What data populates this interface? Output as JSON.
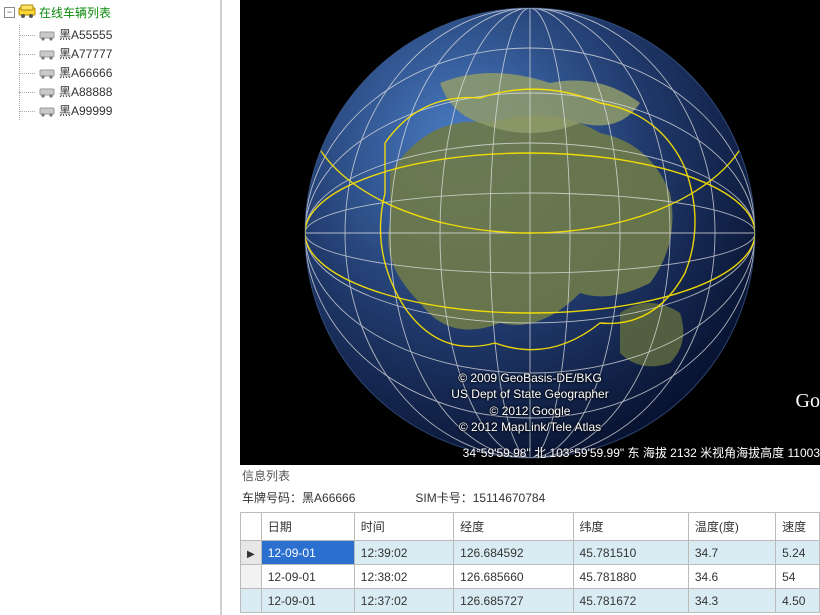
{
  "sidebar": {
    "root_label": "在线车辆列表",
    "items": [
      {
        "plate": "黑A55555"
      },
      {
        "plate": "黑A77777"
      },
      {
        "plate": "黑A66666"
      },
      {
        "plate": "黑A88888"
      },
      {
        "plate": "黑A99999"
      }
    ]
  },
  "globe": {
    "logo": "Go",
    "attrib_line1": "© 2009 GeoBasis-DE/BKG",
    "attrib_line2": "US Dept of State Geographer",
    "attrib_line3": "© 2012 Google",
    "attrib_line4": "© 2012 MapLink/Tele Atlas",
    "status": "34°59'59.98\" 北  103°59'59.99\" 东 海拔  2132 米视角海拔高度 11003"
  },
  "info": {
    "title": "信息列表",
    "plate_label": "车牌号码：",
    "plate_value": "黑A66666",
    "sim_label": "SIM卡号：",
    "sim_value": "15114670784"
  },
  "grid": {
    "columns": {
      "date": "日期",
      "time": "时间",
      "lon": "经度",
      "lat": "纬度",
      "temp": "温度(度)",
      "speed": "速度"
    },
    "rows": [
      {
        "date": "12-09-01",
        "time": "12:39:02",
        "lon": "126.684592",
        "lat": "45.781510",
        "temp": "34.7",
        "speed": "5.24",
        "selected": true
      },
      {
        "date": "12-09-01",
        "time": "12:38:02",
        "lon": "126.685660",
        "lat": "45.781880",
        "temp": "34.6",
        "speed": "54"
      },
      {
        "date": "12-09-01",
        "time": "12:37:02",
        "lon": "126.685727",
        "lat": "45.781672",
        "temp": "34.3",
        "speed": "4.50"
      }
    ]
  }
}
